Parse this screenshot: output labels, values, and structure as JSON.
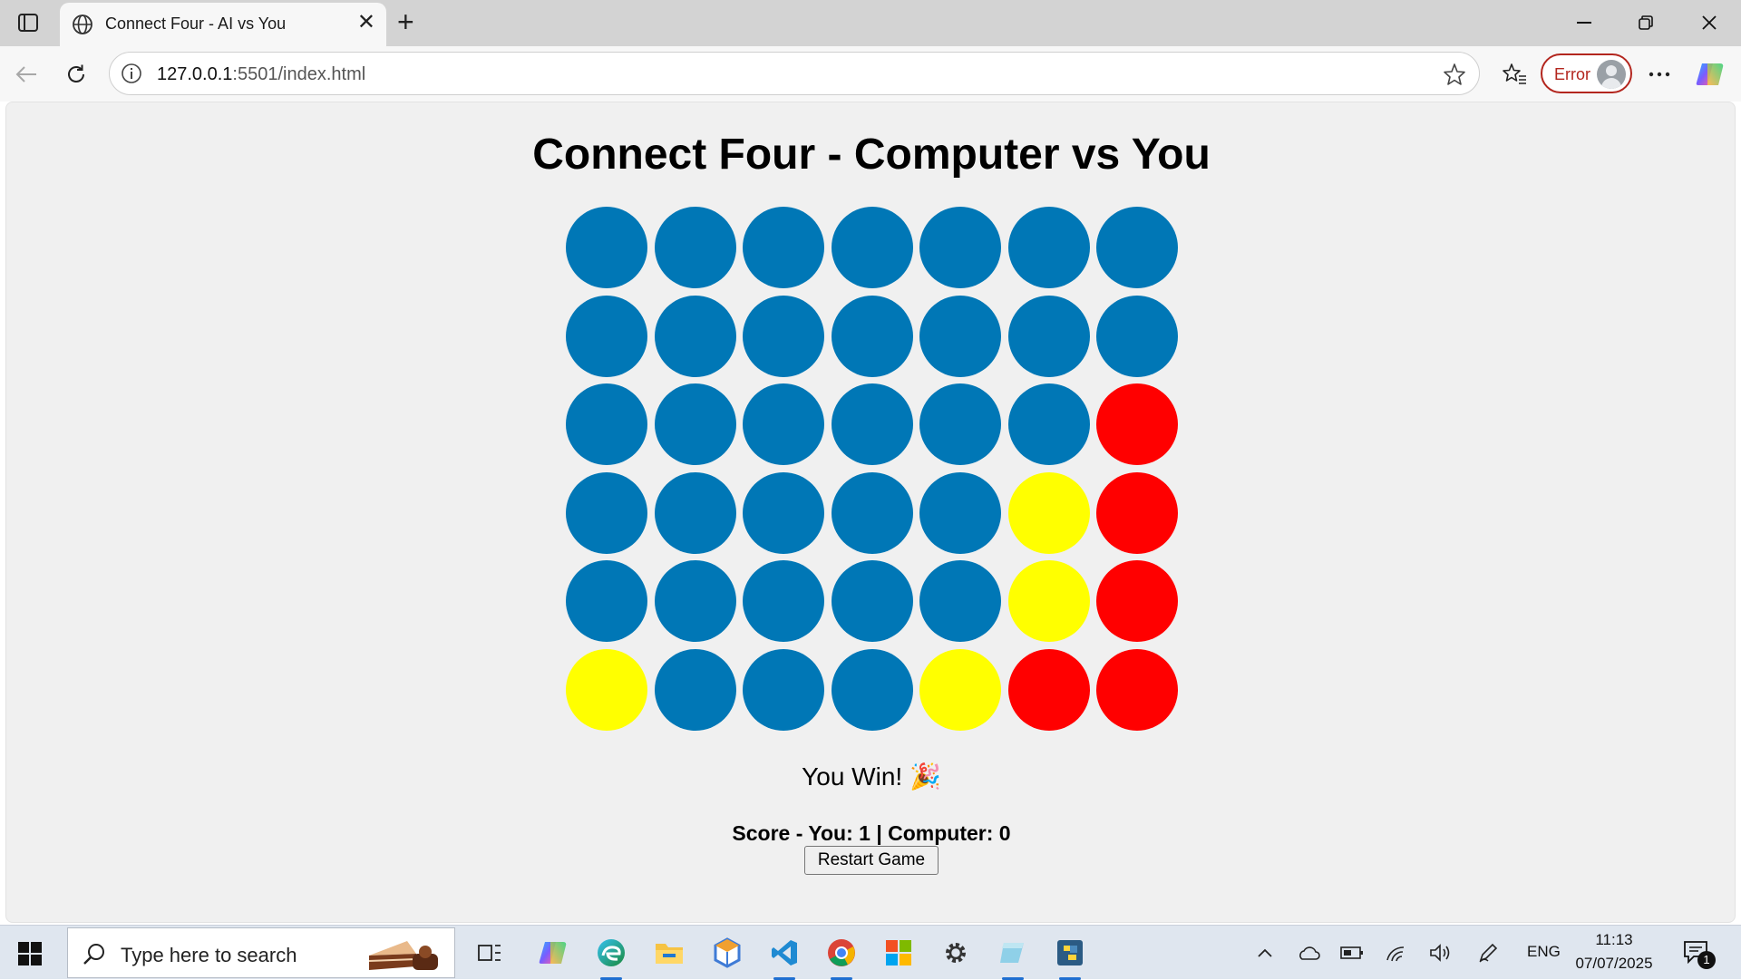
{
  "browser": {
    "tab_title": "Connect Four - AI vs You",
    "url_host": "127.0.0.1",
    "url_path": ":5501/index.html",
    "error_label": "Error"
  },
  "game": {
    "title": "Connect Four - Computer vs You",
    "rows": 6,
    "cols": 7,
    "board": [
      [
        "empty",
        "empty",
        "empty",
        "empty",
        "empty",
        "empty",
        "empty"
      ],
      [
        "empty",
        "empty",
        "empty",
        "empty",
        "empty",
        "empty",
        "empty"
      ],
      [
        "empty",
        "empty",
        "empty",
        "empty",
        "empty",
        "empty",
        "red"
      ],
      [
        "empty",
        "empty",
        "empty",
        "empty",
        "empty",
        "yellow",
        "red"
      ],
      [
        "empty",
        "empty",
        "empty",
        "empty",
        "empty",
        "yellow",
        "red"
      ],
      [
        "yellow",
        "empty",
        "empty",
        "empty",
        "yellow",
        "red",
        "red"
      ]
    ],
    "colors": {
      "empty": "#0077b6",
      "red": "#ff0000",
      "yellow": "#ffff00"
    },
    "result_text": "You Win! 🎉",
    "score_text": "Score - You: 1 | Computer: 0",
    "restart_label": "Restart Game"
  },
  "taskbar": {
    "search_placeholder": "Type here to search",
    "language": "ENG",
    "time": "11:13",
    "date": "07/07/2025",
    "notification_count": "1",
    "apps": [
      "task-view",
      "copilot",
      "edge",
      "file-explorer",
      "3d-viewer",
      "vscode",
      "chrome",
      "microsoft-store",
      "settings",
      "notepad",
      "python"
    ]
  }
}
